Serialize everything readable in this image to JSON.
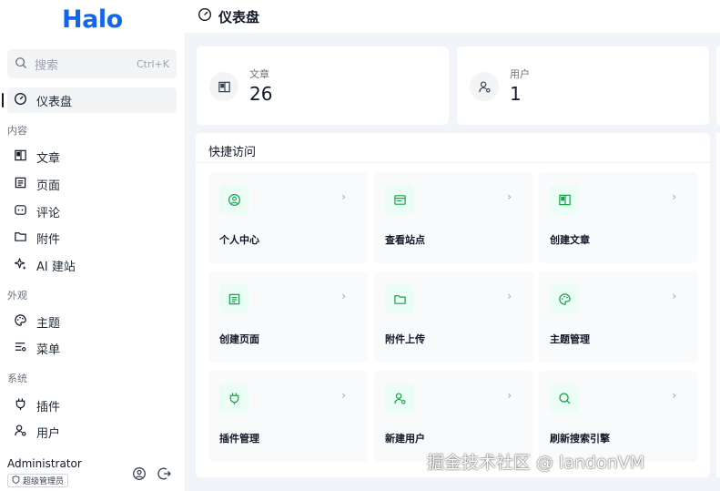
{
  "app": {
    "logo": "Halo"
  },
  "search": {
    "placeholder": "搜索",
    "shortcut": "Ctrl+K"
  },
  "sidebar": {
    "dashboard": "仪表盘",
    "groups": {
      "content": "内容",
      "appearance": "外观",
      "system": "系统"
    },
    "items": {
      "posts": "文章",
      "pages": "页面",
      "comments": "评论",
      "attachments": "附件",
      "ai_site": "AI 建站",
      "themes": "主题",
      "menus": "菜单",
      "plugins": "插件",
      "users": "用户"
    },
    "user": {
      "name": "Administrator",
      "role": "超级管理员"
    }
  },
  "header": {
    "title": "仪表盘"
  },
  "stats": [
    {
      "label": "文章",
      "value": "26"
    },
    {
      "label": "用户",
      "value": "1"
    }
  ],
  "quick_access": {
    "title": "快捷访问",
    "tiles": [
      {
        "label": "个人中心",
        "icon": "user-circle-icon"
      },
      {
        "label": "查看站点",
        "icon": "browser-icon"
      },
      {
        "label": "创建文章",
        "icon": "book-icon"
      },
      {
        "label": "创建页面",
        "icon": "page-icon"
      },
      {
        "label": "附件上传",
        "icon": "folder-icon"
      },
      {
        "label": "主题管理",
        "icon": "palette-icon"
      },
      {
        "label": "插件管理",
        "icon": "plug-icon"
      },
      {
        "label": "新建用户",
        "icon": "user-add-icon"
      },
      {
        "label": "刷新搜索引擎",
        "icon": "search-icon"
      }
    ],
    "chevron": "›"
  },
  "watermark": "掘金技术社区 @ landonVM",
  "colors": {
    "brand": "#1366ec",
    "tile_icon": "#16a34a",
    "tile_icon_bg": "#ecfdf5"
  }
}
